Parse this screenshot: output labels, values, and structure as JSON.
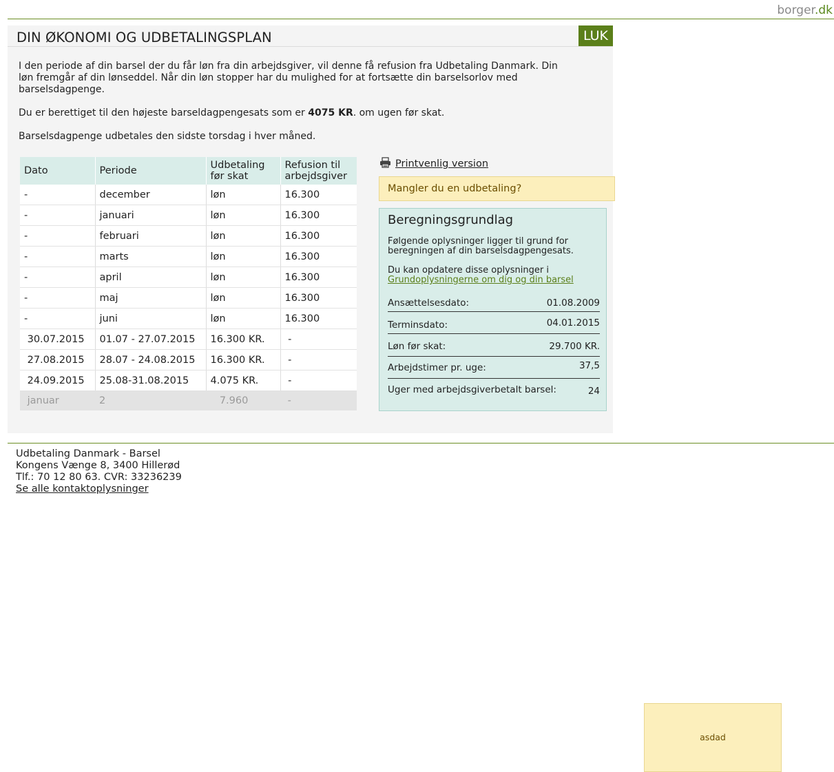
{
  "brand": {
    "part1": "borger",
    "part2": ".dk"
  },
  "header": {
    "title": "DIN ØKONOMI OG UDBETALINGSPLAN",
    "close_label": "LUK"
  },
  "intro": {
    "p1": "I den periode af din barsel der du får løn fra din arbejdsgiver, vil denne få refusion fra Udbetaling Danmark. Din løn fremgår af din lønseddel. Når din løn stopper har du mulighed for at fortsætte din barselsorlov med barselsdagpenge.",
    "p2_before": "Du er berettiget til den højeste barseldagpengesats som er ",
    "p2_amount": "4075 KR",
    "p2_after": ". om ugen før skat.",
    "p3": "Barselsdagpenge udbetales den sidste torsdag i hver måned."
  },
  "table": {
    "headers": [
      "Dato",
      "Periode",
      "Udbetaling før skat",
      "Refusion til arbejdsgiver"
    ],
    "rows": [
      [
        "-",
        "december",
        "løn",
        "16.300"
      ],
      [
        "-",
        "januari",
        "løn",
        "16.300"
      ],
      [
        "-",
        "februari",
        "løn",
        "16.300"
      ],
      [
        "-",
        "marts",
        "løn",
        "16.300"
      ],
      [
        "-",
        "april",
        "løn",
        "16.300"
      ],
      [
        "-",
        "maj",
        "løn",
        "16.300"
      ],
      [
        "-",
        "juni",
        "løn",
        "16.300"
      ],
      [
        " 30.07.2015",
        "01.07 - 27.07.2015",
        "16.300 KR.",
        " -"
      ],
      [
        " 27.08.2015",
        "28.07 - 24.08.2015",
        "16.300 KR.",
        " -"
      ],
      [
        " 24.09.2015",
        "25.08-31.08.2015",
        "4.075 KR.",
        " -"
      ]
    ],
    "muted_row": [
      " januar",
      "2",
      "   7.960",
      " -"
    ]
  },
  "print_link": "Printvenlig version",
  "missing_payment": "Mangler du en udbetaling?",
  "calc": {
    "title": "Beregningsgrundlag",
    "p1": "Følgende oplysninger ligger til grund for beregningen af din barselsdagpengesats.",
    "p2": "Du kan opdatere disse oplysninger i",
    "link": "Grundoplysningerne om dig og din barsel",
    "rows": [
      {
        "label": "Ansættelsesdato:",
        "value": "01.08.2009"
      },
      {
        "label": "Terminsdato:",
        "value": "04.01.2015"
      },
      {
        "label": "Løn før skat:",
        "value": "29.700 KR."
      },
      {
        "label": "Arbejdstimer pr. uge:",
        "value": "37,5"
      },
      {
        "label": "Uger med arbejdsgiverbetalt barsel:",
        "value": "24"
      }
    ]
  },
  "footer": {
    "line1": "Udbetaling Danmark - Barsel",
    "line2": "Kongens Vænge 8, 3400 Hillerød",
    "line3": "Tlf.: 70 12 80 63. CVR: 33236239",
    "link": "Se alle kontaktoplysninger"
  },
  "note": "asdad",
  "colors": {
    "accent": "#5b7f1a",
    "table_header": "#d9ede9",
    "notice": "#fcefbc"
  }
}
